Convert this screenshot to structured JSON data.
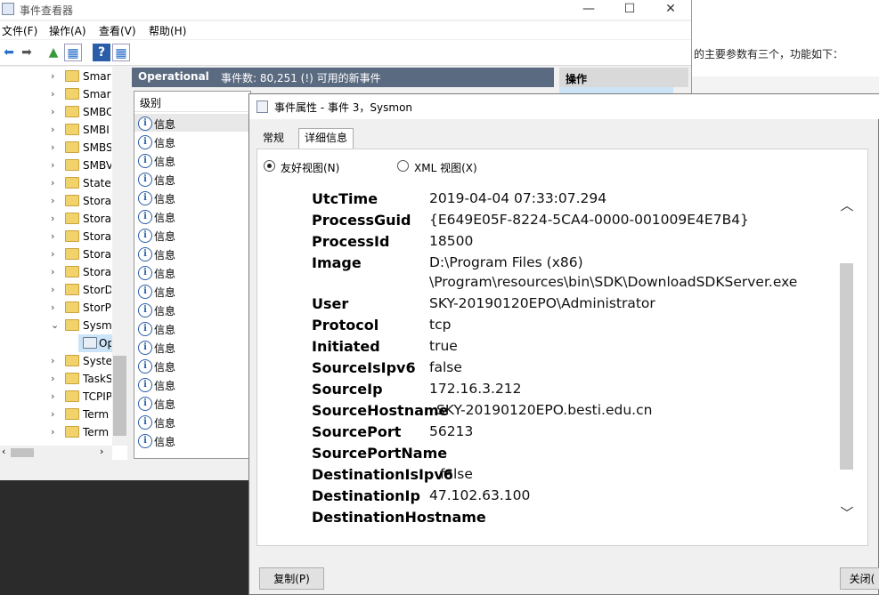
{
  "background_page": {
    "text": "的主要参数有三个，功能如下："
  },
  "event_viewer": {
    "title": "事件查看器",
    "menu": [
      "文件(F)",
      "操作(A)",
      "查看(V)",
      "帮助(H)"
    ],
    "tree_items": [
      "Smar",
      "Smar",
      "SMBC",
      "SMBI",
      "SMBS",
      "SMBV",
      "Statel",
      "Stora",
      "Stora",
      "Stora",
      "Stora",
      "Stora",
      "StorD",
      "StorP",
      "Sysm",
      "Op",
      "Syste",
      "TaskS",
      "TCPIP",
      "Term",
      "Term"
    ],
    "log_name": "Operational",
    "event_count": "事件数: 80,251 (!) 可用的新事件",
    "column_level": "级别",
    "event_level": "信息",
    "event_rows": 18,
    "action_title": "操作"
  },
  "dialog": {
    "title": "事件属性 - 事件 3，Sysmon",
    "tabs": {
      "general": "常规",
      "details": "详细信息"
    },
    "view_friendly": "友好视图(N)",
    "view_xml": "XML 视图(X)",
    "fields": [
      {
        "name": "UtcTime",
        "value": "2019-04-04 07:33:07.294"
      },
      {
        "name": "ProcessGuid",
        "value": "{E649E05F-8224-5CA4-0000-001009E4E7B4}"
      },
      {
        "name": "ProcessId",
        "value": "18500"
      },
      {
        "name": "Image",
        "value": "D:\\Program Files (x86)",
        "value2": "\\Program\\resources\\bin\\SDK\\DownloadSDKServer.exe"
      },
      {
        "name": "User",
        "value": "SKY-20190120EPO\\Administrator"
      },
      {
        "name": "Protocol",
        "value": "tcp"
      },
      {
        "name": "Initiated",
        "value": "true"
      },
      {
        "name": "SourceIsIpv6",
        "value": "false"
      },
      {
        "name": "SourceIp",
        "value": "172.16.3.212"
      },
      {
        "name": "SourceHostname",
        "value": "SKY-20190120EPO.besti.edu.cn"
      },
      {
        "name": "SourcePort",
        "value": "56213"
      },
      {
        "name": "SourcePortName",
        "value": ""
      },
      {
        "name": "DestinationIsIpv6",
        "value": "false"
      },
      {
        "name": "DestinationIp",
        "value": "47.102.63.100"
      },
      {
        "name": "DestinationHostname",
        "value": ""
      }
    ],
    "copy_button": "复制(P)",
    "close_button": "关闭("
  }
}
